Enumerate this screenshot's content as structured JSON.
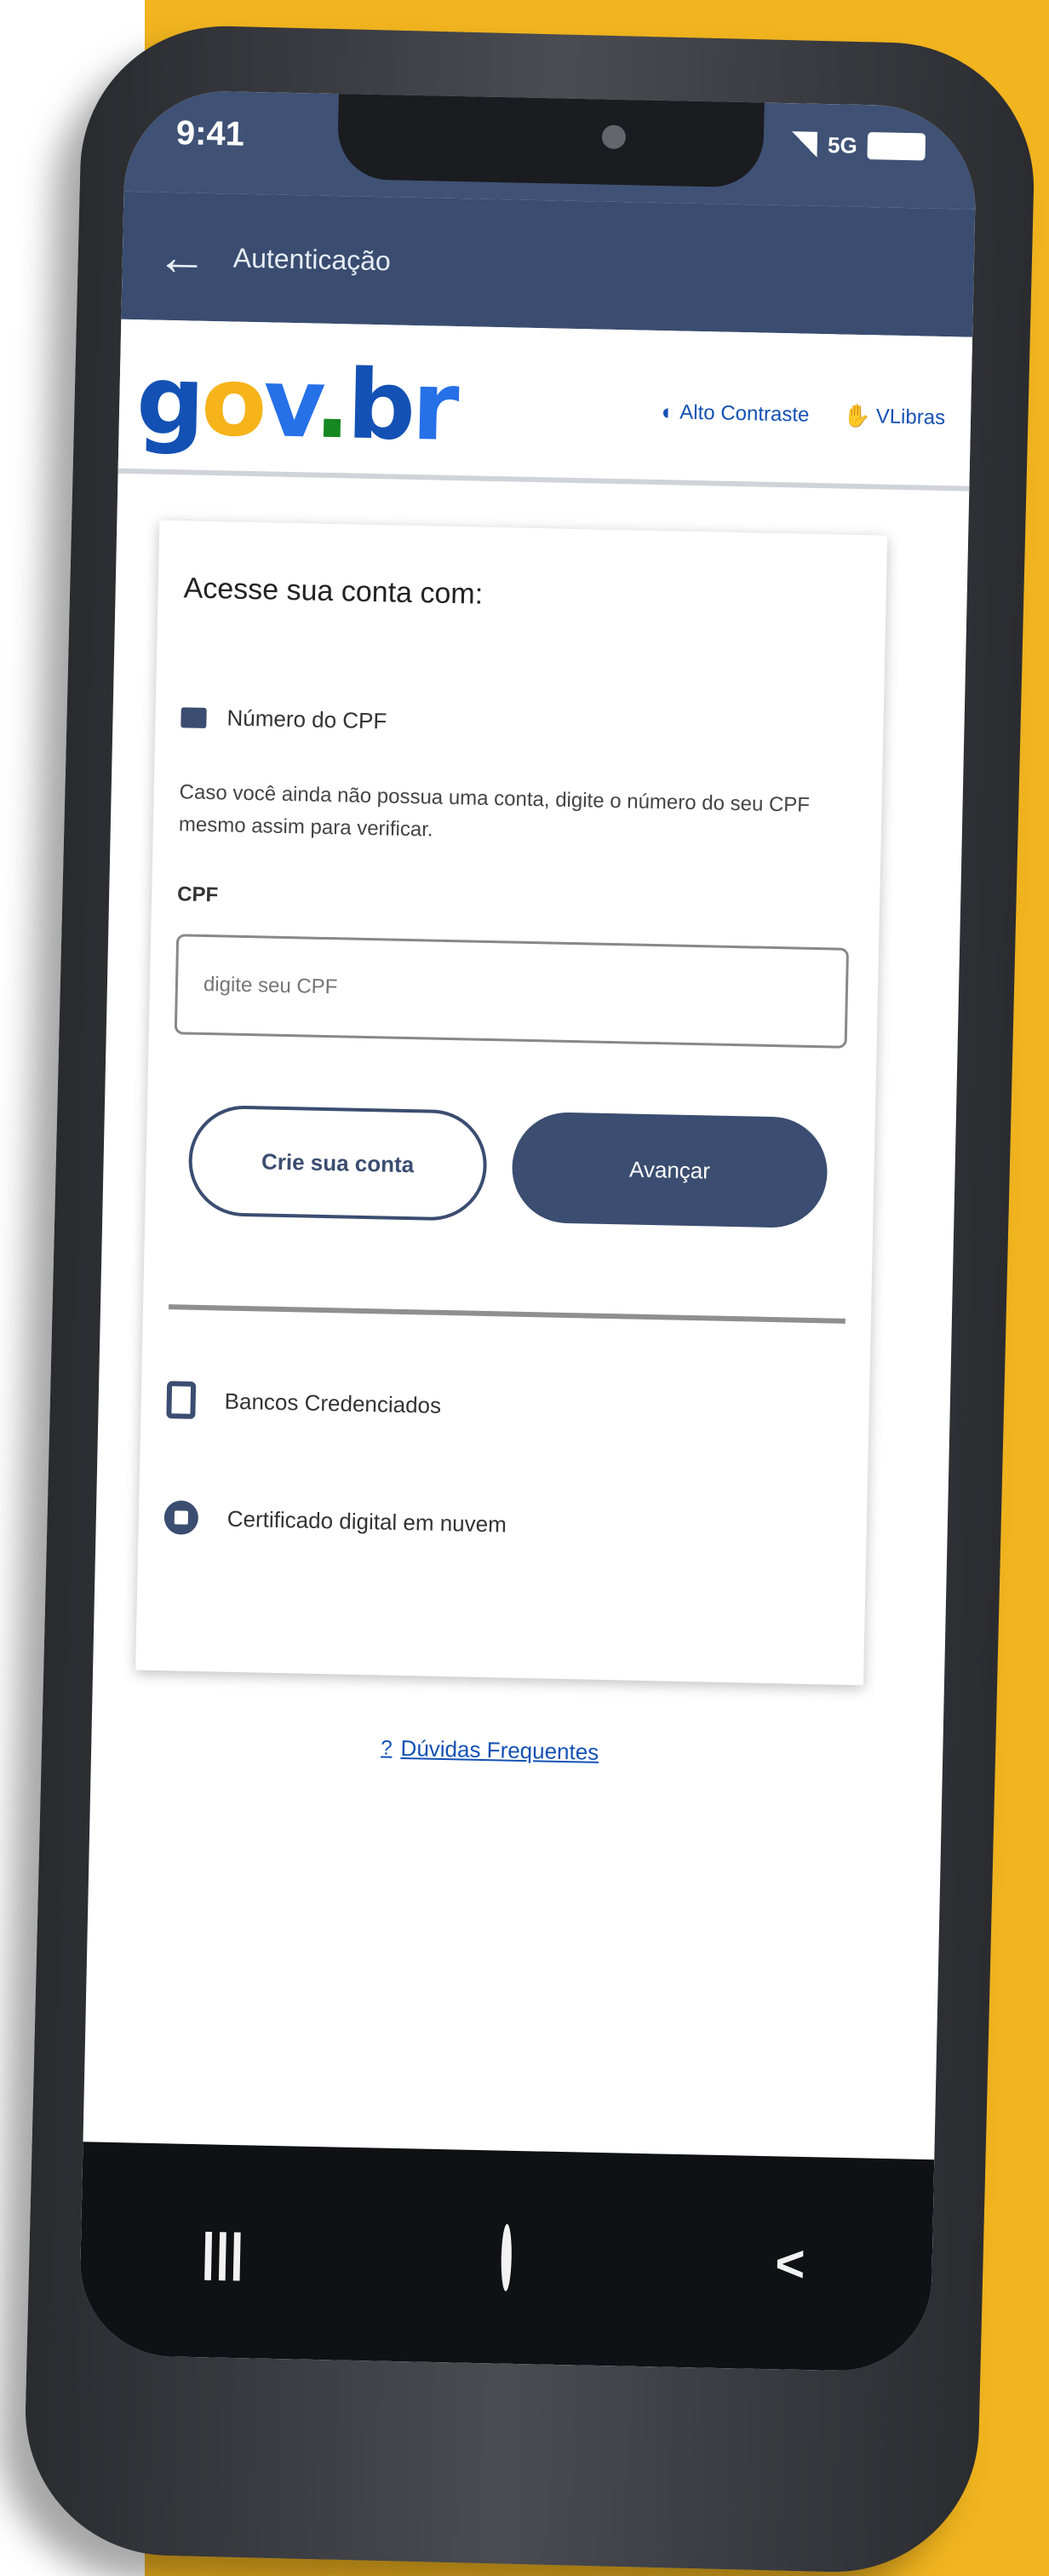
{
  "colors": {
    "brand": "#3b4d70",
    "gov_blue": "#1351b4",
    "accent_yellow": "#f2b51f"
  },
  "statusbar": {
    "time": "9:41",
    "network": "5G"
  },
  "appbar": {
    "back_icon": "arrow-left-icon",
    "title": "Autenticação"
  },
  "govbar": {
    "logo": "gov.br",
    "links": [
      {
        "icon": "contrast-icon",
        "label": "Alto Contraste"
      },
      {
        "icon": "vlibras-icon",
        "label": "VLibras"
      }
    ]
  },
  "card": {
    "title": "Acesse sua conta com:",
    "option_icon": "id-card-icon",
    "option_label": "Número do CPF",
    "info_text": "Caso você ainda não possua uma conta, digite o número do seu CPF mesmo assim para verificar.",
    "cpf_label": "CPF",
    "cpf_placeholder": "digite seu CPF",
    "create_button": "Crie sua conta",
    "advance_button": "Avançar",
    "alternatives": [
      {
        "icon": "bank-icon",
        "label": "Bancos Credenciados"
      },
      {
        "icon": "certificate-icon",
        "label": "Certificado digital em nuvem"
      }
    ]
  },
  "footer": {
    "help_icon": "question-icon",
    "help_label": "Dúvidas Frequentes"
  },
  "navbar": {
    "recent_label": "|||",
    "home_icon": "home-circle-icon",
    "back_label": "<"
  }
}
